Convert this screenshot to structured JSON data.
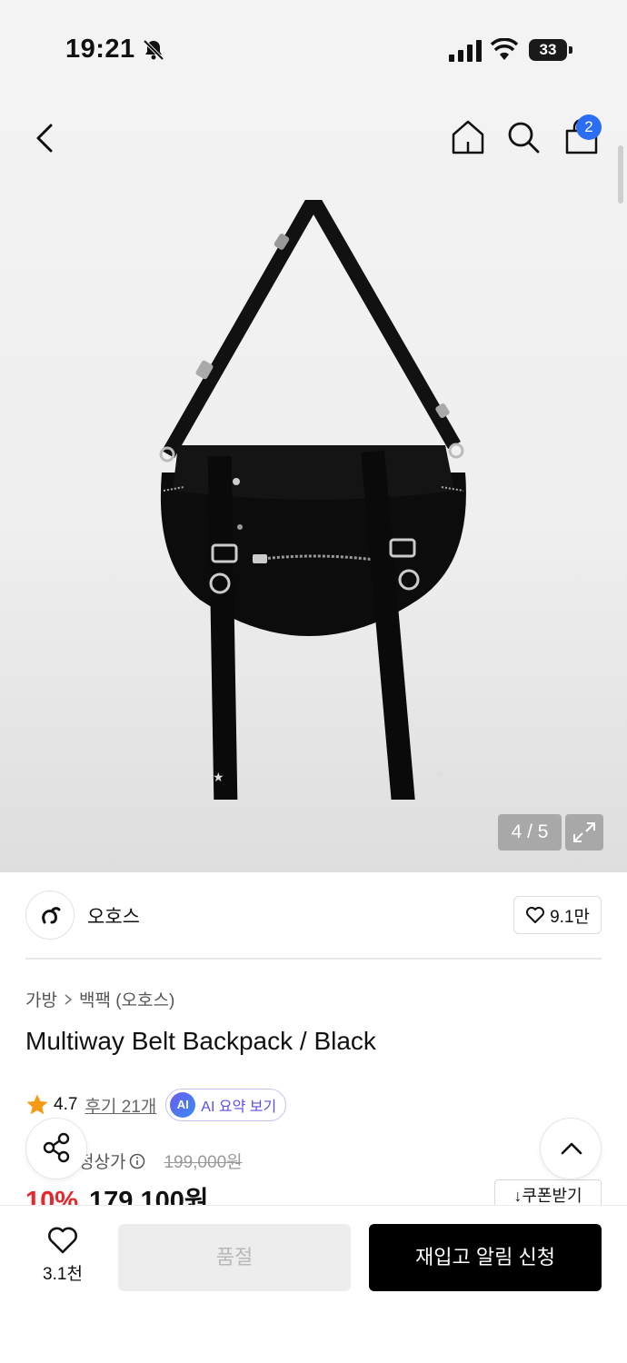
{
  "status_bar": {
    "time": "19:21",
    "battery": "33"
  },
  "header": {
    "cart_count": "2"
  },
  "gallery": {
    "counter": "4 / 5"
  },
  "brand": {
    "name": "오호스",
    "like_count": "9.1만"
  },
  "breadcrumb": {
    "category": "가방",
    "subcategory": "백팩 (오호스)"
  },
  "product": {
    "title": "Multiway Belt Backpack / Black"
  },
  "rating": {
    "score": "4.7",
    "reviews": "후기 21개",
    "ai_badge": "AI",
    "ai_summary": "AI 요약 보기"
  },
  "price": {
    "label": "정상가",
    "original": "199,000원",
    "discount": "10%",
    "sale": "179,100원",
    "coupon": "쿠폰받기"
  },
  "bottom_bar": {
    "wish_count": "3.1천",
    "soldout": "품절",
    "restock": "재입고 알림 신청"
  },
  "colors": {
    "discount_red": "#e8262b",
    "badge_blue": "#2b6df3",
    "ai_purple": "#5b4ee8"
  }
}
